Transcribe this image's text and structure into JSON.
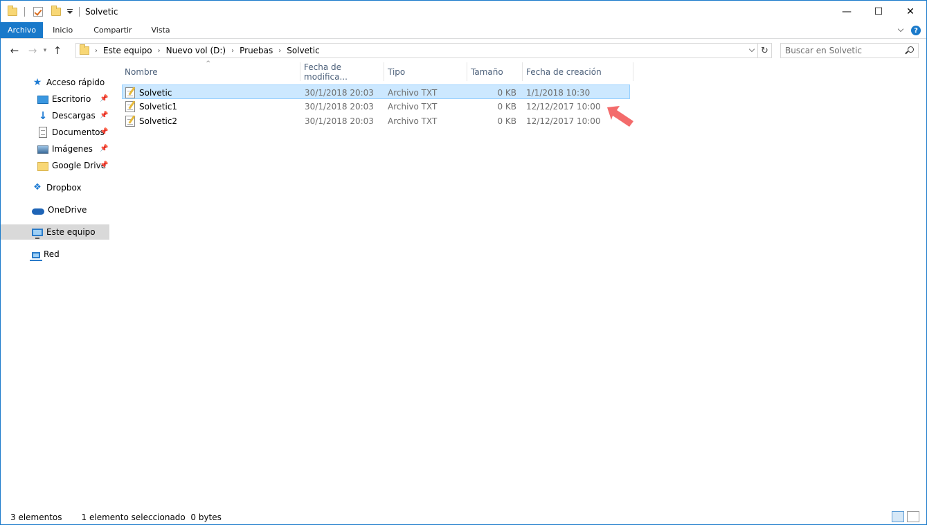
{
  "window": {
    "title": "Solvetic",
    "controls": {
      "minimize": "—",
      "maximize": "☐",
      "close": "✕"
    }
  },
  "ribbon": {
    "tabs": [
      "Archivo",
      "Inicio",
      "Compartir",
      "Vista"
    ],
    "help": "?"
  },
  "address": {
    "breadcrumb": [
      "Este equipo",
      "Nuevo vol (D:)",
      "Pruebas",
      "Solvetic"
    ],
    "search_placeholder": "Buscar en Solvetic"
  },
  "sidebar": {
    "items": [
      {
        "label": "Acceso rápido",
        "icon": "star-icon"
      },
      {
        "label": "Escritorio",
        "icon": "desktop-icon",
        "pinned": true
      },
      {
        "label": "Descargas",
        "icon": "download-icon",
        "pinned": true
      },
      {
        "label": "Documentos",
        "icon": "documents-icon",
        "pinned": true
      },
      {
        "label": "Imágenes",
        "icon": "pictures-icon",
        "pinned": true
      },
      {
        "label": "Google Drive",
        "icon": "folder-icon",
        "pinned": true
      },
      {
        "label": "Dropbox",
        "icon": "dropbox-icon"
      },
      {
        "label": "OneDrive",
        "icon": "onedrive-icon"
      },
      {
        "label": "Este equipo",
        "icon": "this-pc-icon",
        "selected": true
      },
      {
        "label": "Red",
        "icon": "network-icon"
      }
    ]
  },
  "files": {
    "columns": [
      "Nombre",
      "Fecha de modifica...",
      "Tipo",
      "Tamaño",
      "Fecha de creación"
    ],
    "rows": [
      {
        "name": "Solvetic",
        "modified": "30/1/2018 20:03",
        "type": "Archivo TXT",
        "size": "0 KB",
        "created": "1/1/2018 10:30",
        "selected": true
      },
      {
        "name": "Solvetic1",
        "modified": "30/1/2018 20:03",
        "type": "Archivo TXT",
        "size": "0 KB",
        "created": "12/12/2017 10:00"
      },
      {
        "name": "Solvetic2",
        "modified": "30/1/2018 20:03",
        "type": "Archivo TXT",
        "size": "0 KB",
        "created": "12/12/2017 10:00"
      }
    ]
  },
  "status": {
    "count": "3 elementos",
    "selection": "1 elemento seleccionado  0 bytes"
  },
  "colors": {
    "accent": "#1979ca",
    "selected_row": "#cce8ff",
    "annotation_arrow": "#f36b6b"
  }
}
